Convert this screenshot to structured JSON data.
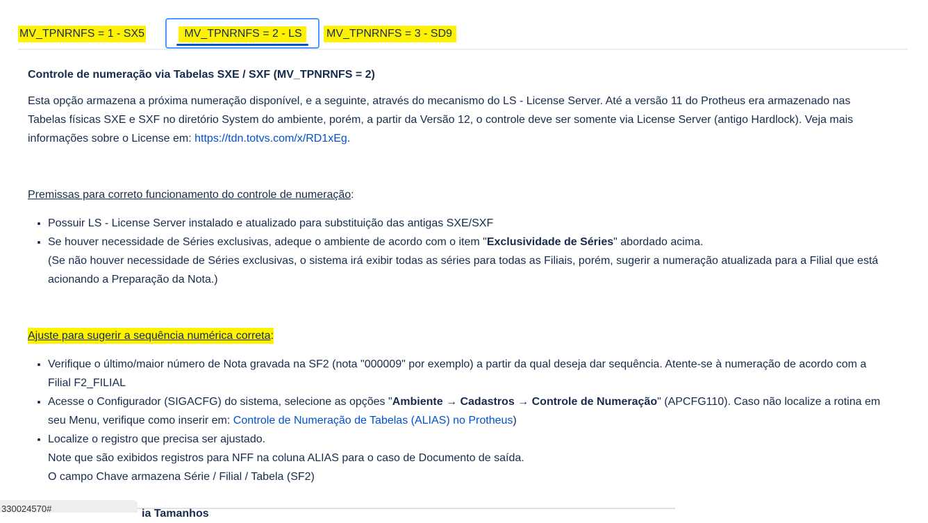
{
  "tabs": [
    {
      "label": "MV_TPNRNFS = 1 - SX5"
    },
    {
      "label": "MV_TPNRNFS = 2 - LS"
    },
    {
      "label": "MV_TPNRNFS = 3 - SD9"
    }
  ],
  "heading": "Controle de numeração via Tabelas SXE / SXF (MV_TPNRNFS = 2)",
  "intro": {
    "text": "Esta opção armazena a próxima numeração disponível, e a seguinte, através do mecanismo do LS - License Server. Até a versão 11 do Protheus era armazenado nas Tabelas físicas SXE e SXF no diretório System do ambiente, porém, a partir da Versão 12, o controle deve ser somente via License Server (antigo Hardlock). Veja mais informações sobre o License em: ",
    "link": "https://tdn.totvs.com/x/RD1xEg",
    "end": "."
  },
  "premissas": {
    "title": "Premissas para correto funcionamento do controle de numeração",
    "colon": ":",
    "item1": "Possuir LS - License Server instalado e atualizado para substituição das antigas SXE/SXF",
    "item2_pre": "Se houver necessidade de Séries exclusivas, adeque o ambiente de acordo com o item \"",
    "item2_bold": "Exclusividade de Séries",
    "item2_post": "\" abordado acima.",
    "item2_note": "(Se não houver necessidade de Séries exclusivas, o sistema irá exibir todas as séries para todas as Filiais, porém, sugerir a numeração atualizada para a Filial que está acionando a Preparação da Nota.)"
  },
  "ajuste": {
    "title": "Ajuste para sugerir a sequência numérica correta",
    "colon": ":",
    "item1": "Verifique o último/maior número de Nota gravada na SF2 (nota \"000009\" por exemplo) a partir da qual deseja dar sequência. Atente-se à numeração de acordo com a Filial F2_FILIAL",
    "item2_pre": "Acesse o Configurador (SIGACFG) do sistema, selecione as opções \"",
    "item2_bold": "Ambiente → Cadastros → Controle de Numeração",
    "item2_mid": "\" (APCFG110). Caso não localize a rotina em seu Menu, verifique como inserir em: ",
    "item2_link": "Controle de Numeração de Tabelas (ALIAS) no Protheus",
    "item2_end": ")",
    "item3_line1": "Localize o registro que precisa ser ajustado.",
    "item3_line2": "Note que são exibidos registros para NFF na coluna ALIAS para o caso de Documento de saída.",
    "item3_line3": "O campo Chave armazena Série / Filial / Tabela (SF2)"
  },
  "status_url": "330024570#",
  "cut_text": "ia Tamanhos",
  "colors": {
    "highlight": "#fff200",
    "link": "#0052cc",
    "active_tab_border": "#4c9aff",
    "text": "#172b4d"
  }
}
